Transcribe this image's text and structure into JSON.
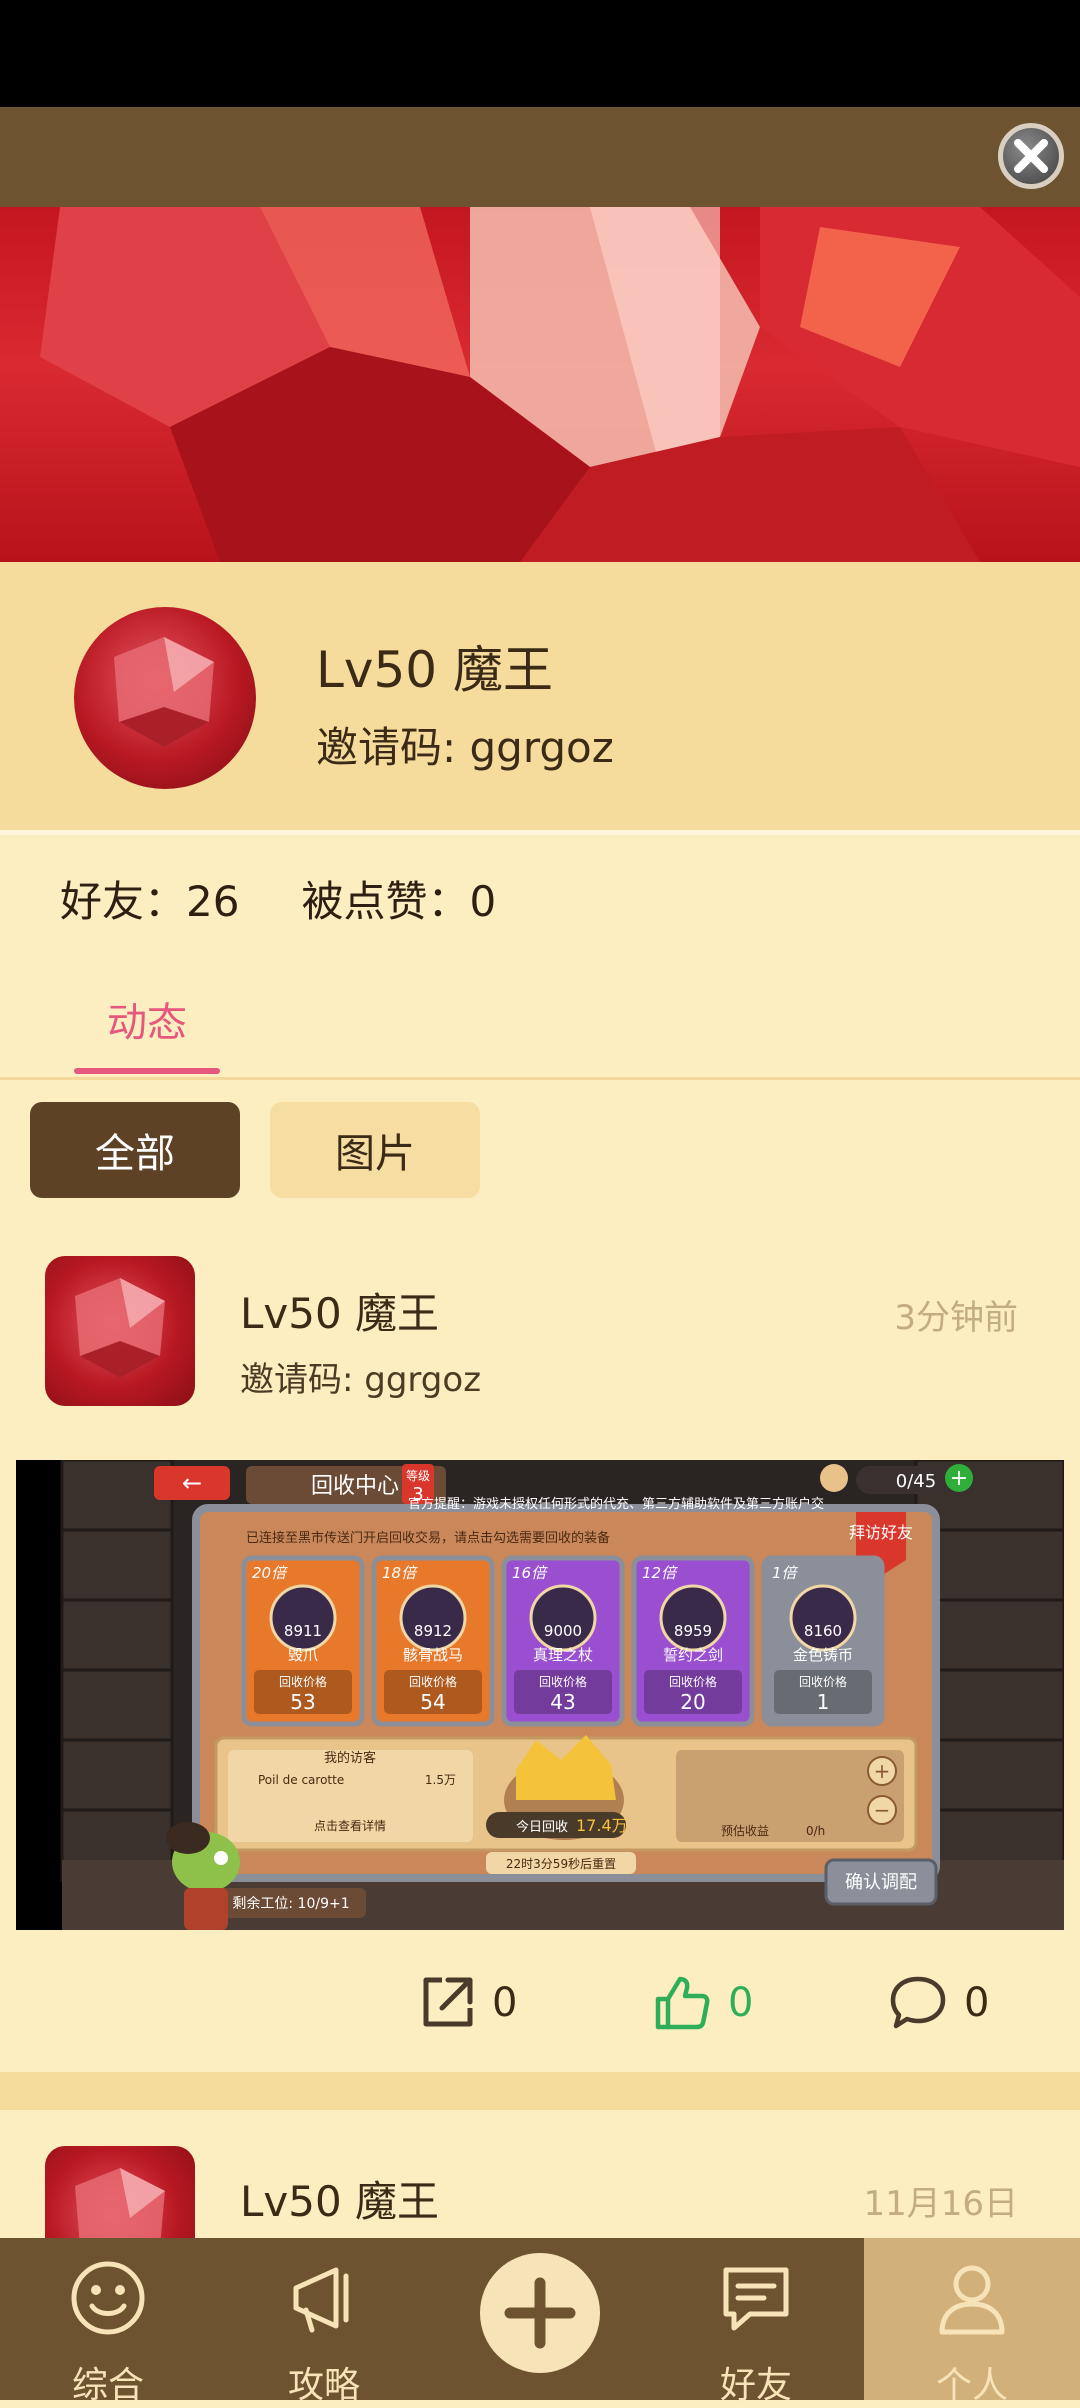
{
  "profile": {
    "name": "Lv50 魔王",
    "invite": "邀请码: ggrgoz"
  },
  "stats": {
    "friends": "好友：26",
    "likes": "被点赞：0"
  },
  "tabs": {
    "active": "动态"
  },
  "filters": {
    "all": "全部",
    "pictures": "图片"
  },
  "posts": [
    {
      "name": "Lv50 魔王",
      "invite": "邀请码: ggrgoz",
      "time": "3分钟前",
      "shares": "0",
      "likes": "0",
      "comments": "0",
      "image": {
        "back_label": "←",
        "title": "回收中心",
        "level_label": "等级",
        "level_value": "3",
        "notice": "官方提醒：游戏未授权任何形式的代充、第三方辅助软件及第三方账户交",
        "sub_notice": "已连接至黑市传送门开启回收交易，请点击勾选需要回收的装备",
        "counter": "0/45",
        "visit_btn": "拜访好友",
        "cards": [
          {
            "mult": "20倍",
            "score": "8911",
            "name": "毁爪",
            "price_label": "回收价格",
            "price": "53",
            "color": "#e8782a"
          },
          {
            "mult": "18倍",
            "score": "8912",
            "name": "骸骨战马",
            "price_label": "回收价格",
            "price": "54",
            "color": "#e8782a"
          },
          {
            "mult": "16倍",
            "score": "9000",
            "name": "真理之杖",
            "price_label": "回收价格",
            "price": "43",
            "color": "#9a4fd0"
          },
          {
            "mult": "12倍",
            "score": "8959",
            "name": "誓约之剑",
            "price_label": "回收价格",
            "price": "20",
            "color": "#9a4fd0"
          },
          {
            "mult": "1倍",
            "score": "8160",
            "name": "金色铸币",
            "price_label": "回收价格",
            "price": "1",
            "color": "#8a8f99"
          }
        ],
        "visitors_title": "我的访客",
        "visitor_name": "Poil de carotte",
        "visitor_value": "1.5万",
        "visitors_more": "点击查看详情",
        "today_label": "今日回收",
        "today_value": "17.4万",
        "estimate_label": "预估收益",
        "estimate_value": "0/h",
        "reset": "22时3分59秒后重置",
        "workers": "剩余工位: 10/9+1",
        "confirm_btn": "确认调配"
      }
    },
    {
      "name": "Lv50 魔王",
      "time": "11月16日"
    }
  ],
  "nav": [
    {
      "label": "综合",
      "icon": "smile-icon"
    },
    {
      "label": "攻略",
      "icon": "megaphone-icon"
    },
    {
      "label": "",
      "icon": "plus-icon"
    },
    {
      "label": "好友",
      "icon": "chat-icon"
    },
    {
      "label": "个人",
      "icon": "person-icon"
    }
  ],
  "colors": {
    "bg": "#fdeec2",
    "brown": "#6e5330",
    "accent": "#e4587e",
    "like": "#2fae59"
  }
}
